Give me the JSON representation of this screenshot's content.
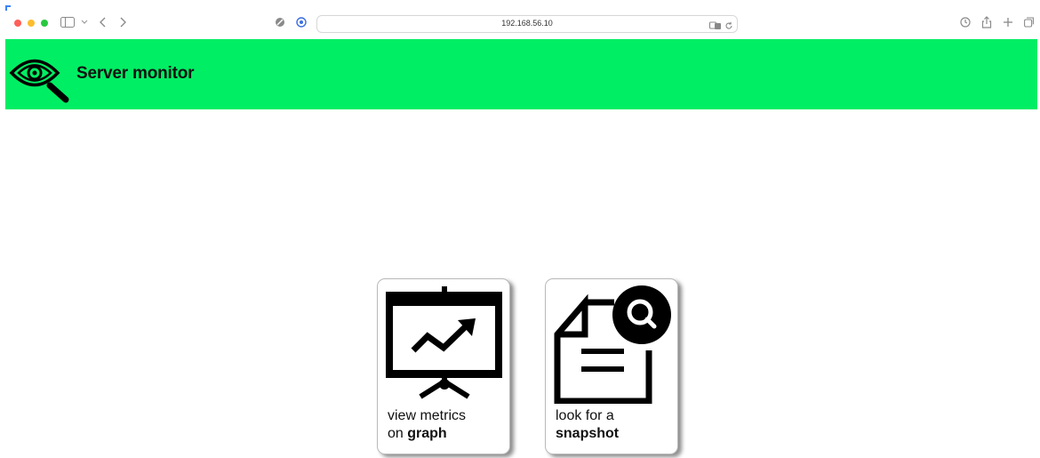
{
  "browser": {
    "address": "192.168.56.10"
  },
  "header": {
    "title": "Server monitor",
    "background": "#00ee64",
    "logo_icon": "eye-magnifier-icon"
  },
  "tiles": [
    {
      "id": "graph",
      "line1": "view metrics",
      "line2_prefix": "on ",
      "line2_bold": "graph",
      "icon": "presentation-chart-icon"
    },
    {
      "id": "snapshot",
      "line1": "look for a",
      "line2_prefix": "",
      "line2_bold": "snapshot",
      "icon": "document-search-icon"
    }
  ]
}
